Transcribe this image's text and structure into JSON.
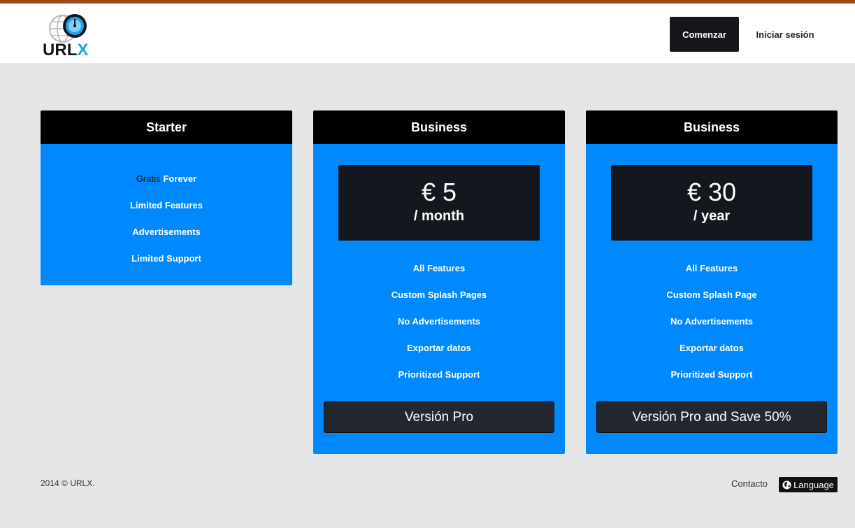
{
  "brand": {
    "logo_text": "URLX",
    "colors": {
      "logo_dark": "#15151c",
      "logo_blue": "#1aa3e8"
    }
  },
  "header": {
    "start_label": "Comenzar",
    "login_label": "Iniciar sesión"
  },
  "plans": [
    {
      "title": "Starter",
      "features": [
        {
          "prefix": "Gratis",
          "text": "Forever"
        },
        {
          "text": "Limited Features"
        },
        {
          "text": "Advertisements"
        },
        {
          "text": "Limited Support"
        }
      ]
    },
    {
      "title": "Business",
      "price": "€ 5",
      "period": "/ month",
      "features": [
        "All Features",
        "Custom Splash Pages",
        "No Advertisements",
        "Exportar datos",
        "Prioritized Support"
      ],
      "button_label": "Versión Pro"
    },
    {
      "title": "Business",
      "price": "€ 30",
      "period": "/ year",
      "features": [
        "All Features",
        "Custom Splash Page",
        "No Advertisements",
        "Exportar datos",
        "Prioritized Support"
      ],
      "button_label": "Versión Pro and Save 50%"
    }
  ],
  "footer": {
    "copyright": "2014 © URLX.",
    "contact_label": "Contacto",
    "language_label": "Language"
  },
  "colors": {
    "accent_bar": "#a0471b",
    "card_blue": "#0088ff",
    "card_header": "#000000",
    "page_bg": "#e6e6e6"
  }
}
